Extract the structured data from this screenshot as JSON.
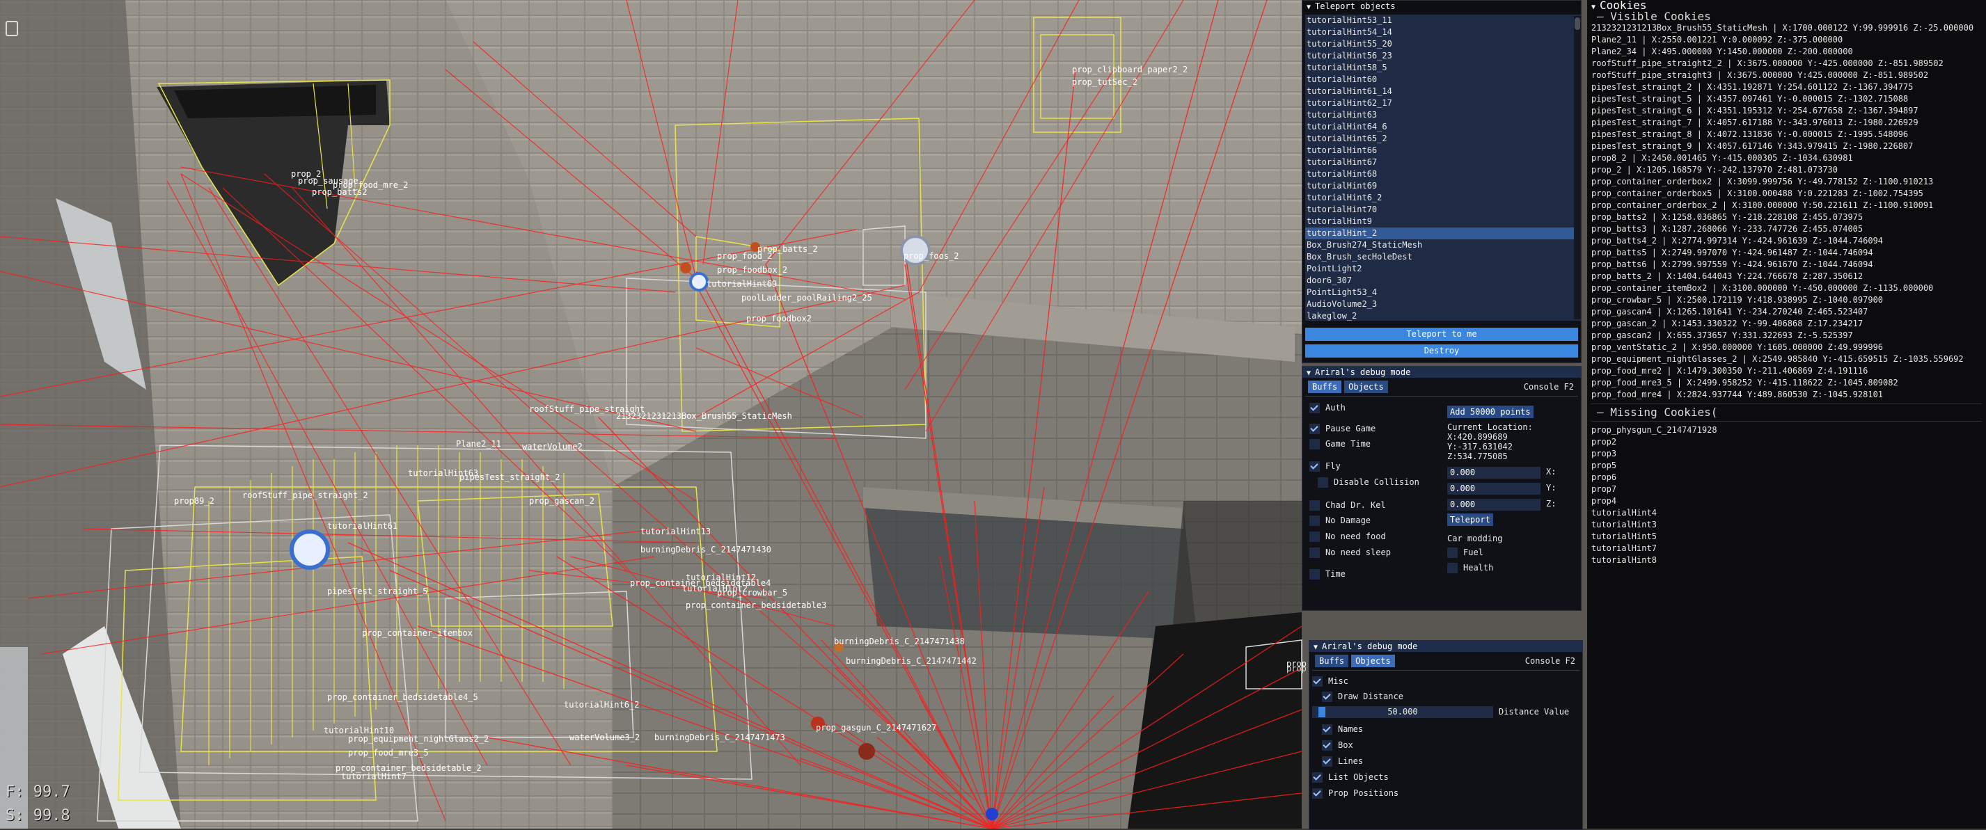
{
  "hud": {
    "fps_label": "F: 99.7",
    "s_label": "S: 99.8"
  },
  "scene_labels": [
    "prop_clipboard_paper2_2",
    "prop_tutSec_2",
    "prop_2",
    "prop_sausage",
    "prop_food_mre_2",
    "prop_batts2",
    "prop_food_2",
    "prop_batts_2",
    "prop_foodbox_2",
    "tutorialHint69",
    "poolLadder_poolRailing2_25",
    "prop_foodbox2",
    "prop_foos_2",
    "roofStuff_pipe_straight",
    "2132321231213Box_Brush55_StaticMesh",
    "Plane2_11",
    "waterVolume2",
    "tutorialHint63",
    "pipesTest_straight_2",
    "prop_gascan_2",
    "prop89_2",
    "roofStuff_pipe_straight_2",
    "tutorialHint61",
    "tutorialHint13",
    "burningDebris_C_2147471430",
    "pipesTest_straight_5",
    "prop_container_bedsidetable4",
    "tutorialHint12",
    "tutorialHint2",
    "prop_crowbar_5",
    "prop_container_bedsidetable3",
    "prop_container_itembox",
    "tutorialHint10",
    "burningDebris_C_2147471438",
    "burningDebris_C_2147471442",
    "tutorialHint6_2",
    "prop_container_bedsidetable4_5",
    "waterVolume3_2",
    "burningDebris_C_2147471473",
    "prop_gasgun_C_2147471627",
    "prop_equipment_nightGlass2_2",
    "prop_food_mre3_5",
    "prop_container_bedsidetable_2",
    "prop",
    "tutorialHint7"
  ],
  "teleport": {
    "title": "Teleport objects",
    "items": [
      "tutorialHint53_11",
      "tutorialHint54_14",
      "tutorialHint55_20",
      "tutorialHint56_23",
      "tutorialHint58_5",
      "tutorialHint60",
      "tutorialHint61_14",
      "tutorialHint62_17",
      "tutorialHint63",
      "tutorialHint64_6",
      "tutorialHint65_2",
      "tutorialHint66",
      "tutorialHint67",
      "tutorialHint68",
      "tutorialHint69",
      "tutorialHint6_2",
      "tutorialHint70",
      "tutorialHint9",
      "tutorialHint_2",
      "Box_Brush274_StaticMesh",
      "Box_Brush_secHoleDest",
      "PointLight2",
      "door6_307",
      "PointLight53_4",
      "AudioVolume2_3",
      "lakeglow_2"
    ],
    "selected_index": 18,
    "teleport_button": "Teleport to me",
    "destroy_button": "Destroy"
  },
  "debug1": {
    "title": "Ariral's debug mode",
    "tab_buffs": "Buffs",
    "tab_objects": "Objects",
    "console": "Console F2",
    "auth": "Auth",
    "pause_game": "Pause Game",
    "game_time": "Game Time",
    "fly": "Fly",
    "disable_collision": "Disable Collision",
    "chad": "Chad Dr. Kel",
    "no_damage": "No Damage",
    "no_food": "No need food",
    "no_sleep": "No need sleep",
    "time": "Time",
    "add_points": "Add 50000 points",
    "current_location": "Current Location:",
    "loc_x": "X:420.899689",
    "loc_y": "Y:-317.631042",
    "loc_z": "Z:534.775085",
    "x_val": "0.000",
    "y_val": "0.000",
    "z_val": "0.000",
    "x_label": "X:",
    "y_label": "Y:",
    "z_label": "Z:",
    "teleport_btn": "Teleport",
    "car_modding": "Car modding",
    "fuel": "Fuel",
    "health": "Health"
  },
  "debug2": {
    "title": "Ariral's debug mode",
    "tab_buffs": "Buffs",
    "tab_objects": "Objects",
    "console": "Console F2",
    "misc": "Misc",
    "draw_distance": "Draw Distance",
    "distance_value": "50.000",
    "distance_fraction": 0.03,
    "distance_label": "Distance Value",
    "names": "Names",
    "box": "Box",
    "lines": "Lines",
    "list_objects": "List Objects",
    "prop_positions": "Prop Positions",
    "prop_partial": "prop"
  },
  "cookies": {
    "title": "Cookies",
    "visible_title": "Visible Cookies",
    "visible": [
      "2132321231213Box_Brush55_StaticMesh | X:1700.000122 Y:99.999916 Z:-25.000000",
      "Plane2_11 | X:2550.001221 Y:0.000092 Z:-375.000000",
      "Plane2_34 | X:495.000000 Y:1450.000000 Z:-200.000000",
      "roofStuff_pipe_straight2_2 | X:3675.000000 Y:-425.000000 Z:-851.989502",
      "roofStuff_pipe_straight3 | X:3675.000000 Y:425.000000 Z:-851.989502",
      "pipesTest_straingt_2 | X:4351.192871 Y:254.601122 Z:-1367.394775",
      "pipesTest_straingt_5 | X:4357.097461 Y:-0.000015 Z:-1302.715088",
      "pipesTest_straingt_6 | X:4351.195312 Y:-254.677658 Z:-1367.394897",
      "pipesTest_straingt_7 | X:4057.617188 Y:-343.976013 Z:-1980.226929",
      "pipesTest_straingt_8 | X:4072.131836 Y:-0.000015 Z:-1995.548096",
      "pipesTest_straingt_9 | X:4057.617146 Y:343.979415 Z:-1980.226807",
      "prop8_2 | X:2450.001465 Y:-415.000305 Z:-1034.630981",
      "prop_2 | X:1205.168579 Y:-242.137970 Z:481.073730",
      "prop_container_orderbox2 | X:3099.999756 Y:-49.778152 Z:-1100.910213",
      "prop_container_orderbox5 | X:3100.000488 Y:0.221283 Z:-1002.754395",
      "prop_container_orderbox_2 | X:3100.000000 Y:50.221611 Z:-1100.910091",
      "prop_batts2 | X:1258.036865 Y:-218.228108 Z:455.073975",
      "prop_batts3 | X:1287.268066 Y:-233.747726 Z:455.074005",
      "prop_batts4_2 | X:2774.997314 Y:-424.961639 Z:-1044.746094",
      "prop_batts5 | X:2749.997070 Y:-424.961487 Z:-1044.746094",
      "prop_batts6 | X:2799.997559 Y:-424.961670 Z:-1044.746094",
      "prop_batts_2 | X:1404.644043 Y:224.766678 Z:287.350612",
      "prop_container_itemBox2 | X:3100.000000 Y:-450.000000 Z:-1135.000000",
      "prop_crowbar_5 | X:2500.172119 Y:418.938995 Z:-1040.097900",
      "prop_gascan4 | X:1265.101641 Y:-234.270240 Z:465.523407",
      "prop_gascan_2 | X:1453.330322 Y:-99.406868 Z:17.234217",
      "prop_gascan2 | X:655.373657 Y:331.322693 Z:-5.525397",
      "prop_ventStatic_2 | X:950.000000 Y:1605.000000 Z:49.999996",
      "prop_equipment_nightGlasses_2 | X:2549.985840 Y:-415.659515 Z:-1035.559692",
      "prop_food_mre2 | X:1479.300350 Y:-211.406869 Z:4.191116",
      "prop_food_mre3_5 | X:2499.958252 Y:-415.118622 Z:-1045.809082",
      "prop_food_mre4 | X:2824.937744 Y:489.860530 Z:-1045.928101"
    ],
    "missing_title": "Missing Cookies(",
    "missing": [
      "prop_physgun_C_2147471928",
      "prop2",
      "prop3",
      "prop5",
      "prop6",
      "prop7",
      "prop4",
      "tutorialHint4",
      "tutorialHint3",
      "tutorialHint5",
      "tutorialHint7",
      "tutorialHint8"
    ]
  }
}
